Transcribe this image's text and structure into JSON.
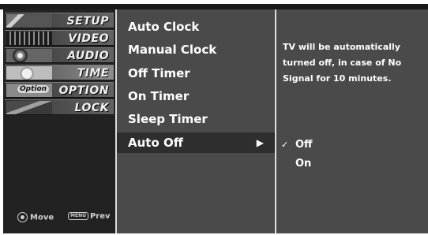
{
  "categories": [
    {
      "label": "SETUP",
      "icon": "satellite-dish-icon"
    },
    {
      "label": "VIDEO",
      "icon": "film-reel-icon"
    },
    {
      "label": "AUDIO",
      "icon": "speaker-icon"
    },
    {
      "label": "TIME",
      "icon": "clock-icon"
    },
    {
      "label": "OPTION",
      "icon": "option-badge-icon",
      "thumb_text": "Option"
    },
    {
      "label": "LOCK",
      "icon": "lock-icon"
    }
  ],
  "active_category": "TIME",
  "footer": {
    "move_label": "Move",
    "menu_key": "MENU",
    "prev_label": "Prev"
  },
  "menu": {
    "items": [
      {
        "label": "Auto Clock"
      },
      {
        "label": "Manual Clock"
      },
      {
        "label": "Off Timer"
      },
      {
        "label": "On Timer"
      },
      {
        "label": "Sleep Timer"
      },
      {
        "label": "Auto Off",
        "arrow": "▶"
      }
    ],
    "selected": "Auto Off"
  },
  "info": {
    "description": "TV will be automatically turned off, in case of No Signal for 10 minutes.",
    "options": [
      {
        "label": "Off",
        "check": "✓"
      },
      {
        "label": "On",
        "check": ""
      }
    ]
  },
  "colors": {
    "panel": "#4a4a4a",
    "selected_row": "#2e2e2e",
    "text": "#ffffff"
  }
}
